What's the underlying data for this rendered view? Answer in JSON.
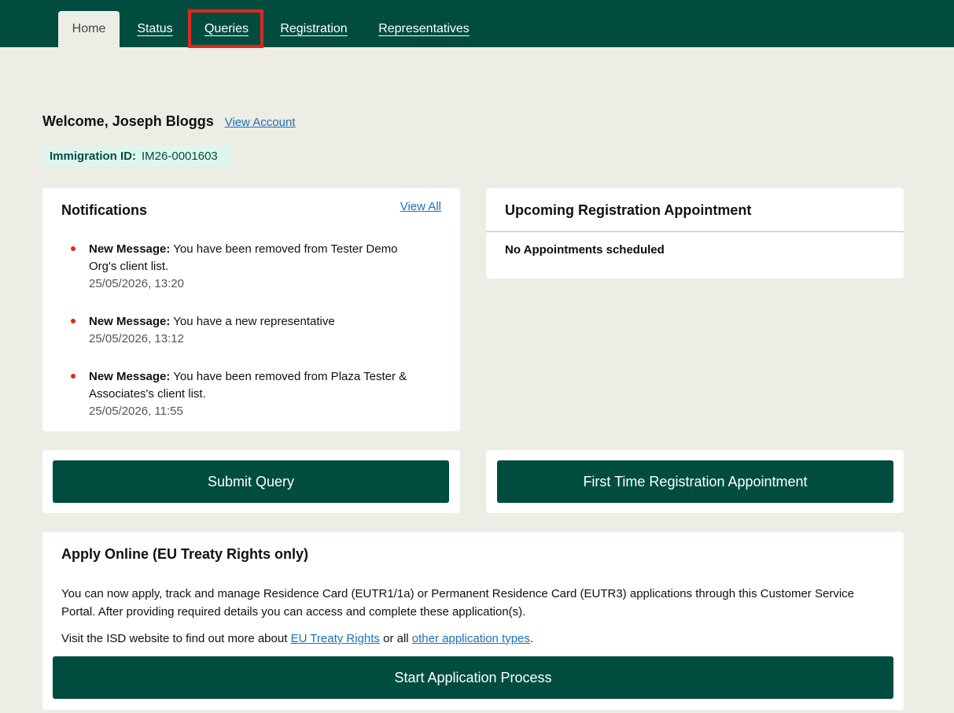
{
  "nav": {
    "tabs": [
      {
        "label": "Home",
        "active": true
      },
      {
        "label": "Status"
      },
      {
        "label": "Queries"
      },
      {
        "label": "Registration"
      },
      {
        "label": "Representatives"
      }
    ]
  },
  "welcome": {
    "text": "Welcome, Joseph Bloggs",
    "view_account": "View Account"
  },
  "immigration": {
    "label": "Immigration ID:",
    "value": "IM26-0001603"
  },
  "notifications": {
    "title": "Notifications",
    "view_all": "View All",
    "items": [
      {
        "prefix": "New Message:",
        "text": "You have been removed from Tester Demo Org's client list.",
        "date": "25/05/2026, 13:20"
      },
      {
        "prefix": "New Message:",
        "text": "You have a new representative",
        "date": "25/05/2026, 13:12"
      },
      {
        "prefix": "New Message:",
        "text": "You have been removed from Plaza Tester & Associates's client list.",
        "date": "25/05/2026, 11:55"
      }
    ]
  },
  "appointment": {
    "title": "Upcoming Registration Appointment",
    "empty": "No Appointments scheduled"
  },
  "buttons": {
    "submit_query": "Submit Query",
    "first_time": "First Time Registration Appointment",
    "start_app": "Start Application Process"
  },
  "apply": {
    "title": "Apply Online (EU Treaty Rights only)",
    "paragraph1": "You can now apply, track and manage Residence Card (EUTR1/1a) or Permanent Residence Card (EUTR3) applications through this Customer Service Portal. After providing required details you can access and complete these application(s).",
    "visit_prefix": "Visit the ISD website to find out more about",
    "link1": "EU Treaty Rights",
    "middle": "or all",
    "link2": "other application types",
    "suffix": "."
  },
  "colors": {
    "brand": "#004d40",
    "background": "#edece5",
    "link": "#1d70b8",
    "highlight": "#e0261d"
  }
}
